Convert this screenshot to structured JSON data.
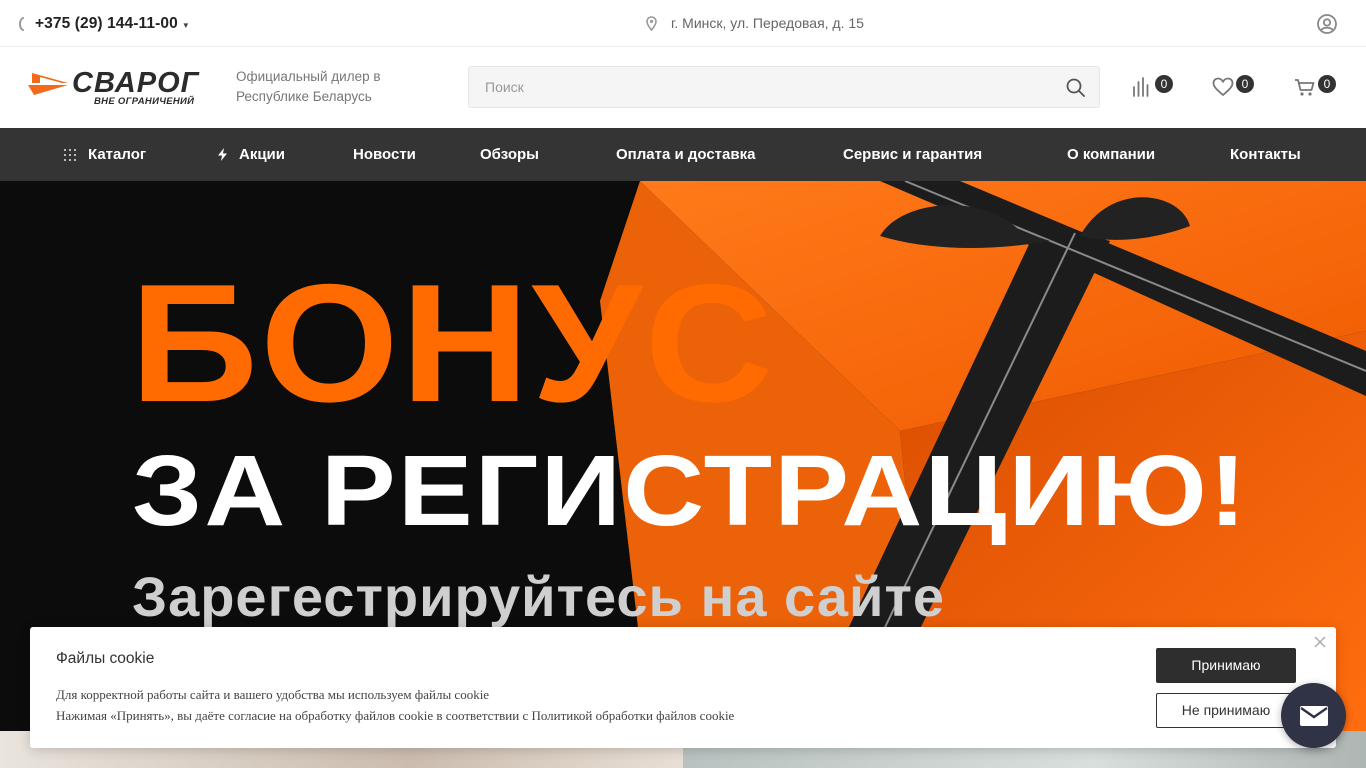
{
  "topbar": {
    "phone": "+375 (29) 144-11-00",
    "address": "г. Минск, ул. Передовая, д. 15"
  },
  "header": {
    "logo_name": "СВАРОГ",
    "logo_slogan": "ВНЕ ОГРАНИЧЕНИЙ",
    "dealer_line1": "Официальный дилер в",
    "dealer_line2": "Республике Беларусь",
    "search_placeholder": "Поиск",
    "compare_count": "0",
    "favorites_count": "0",
    "cart_count": "0"
  },
  "nav": {
    "items": [
      {
        "label": "Каталог"
      },
      {
        "label": "Акции"
      },
      {
        "label": "Новости"
      },
      {
        "label": "Обзоры"
      },
      {
        "label": "Оплата и доставка"
      },
      {
        "label": "Сервис и гарантия"
      },
      {
        "label": "О компании"
      },
      {
        "label": "Контакты"
      }
    ]
  },
  "banner": {
    "headline": "БОНУС",
    "subheadline": "ЗА РЕГИСТРАЦИЮ!",
    "caption": "Зарегестрируйтесь на сайте"
  },
  "cookie": {
    "title": "Файлы cookie",
    "text1": "Для корректной работы сайта и вашего удобства мы используем файлы cookie",
    "text2": "Нажимая «Принять», вы даёте согласие на обработку файлов cookie в соответствии с Политикой обработки файлов cookie",
    "accept_label": "Принимаю",
    "decline_label": "Не принимаю"
  },
  "colors": {
    "accent": "#ff6b00",
    "nav_bg": "#343434",
    "badge_bg": "#333333"
  }
}
